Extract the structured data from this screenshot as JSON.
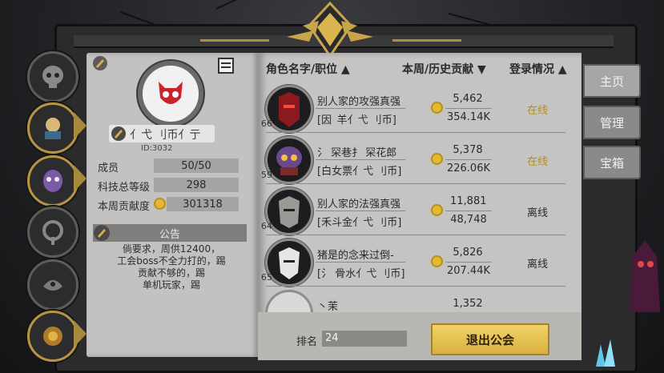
{
  "colors": {
    "gold": "#d9b13f",
    "online": "#b8901c",
    "offline": "#2a2a2a",
    "page": "#c6c4c2"
  },
  "tabs": [
    {
      "label": "主页",
      "active": true
    },
    {
      "label": "管理",
      "active": false
    },
    {
      "label": "宝箱",
      "active": false
    }
  ],
  "side_icons": [
    "skull-icon",
    "knight-icon",
    "purple-mask-icon",
    "orb-icon",
    "crow-icon",
    "golden-emblem-icon"
  ],
  "guild": {
    "name": "亻弋 刂币亻亍",
    "id": "ID:3032",
    "stats": [
      {
        "label": "成员",
        "value": "50/50"
      },
      {
        "label": "科技总等级",
        "value": "298"
      },
      {
        "label": "本周贡献度",
        "value": "301318"
      }
    ],
    "notice_title": "公告",
    "notice_lines": [
      "倘要求，周供12400，",
      "工会boss不全力打的，踢",
      "贡献不够的，踢",
      "单机玩家，踢"
    ]
  },
  "table": {
    "headers": {
      "name": "角色名字/职位 ▲",
      "contrib": "本周/历史贡献 ▼",
      "login": "登录情况 ▲"
    },
    "rows": [
      {
        "level": "66",
        "name": "别人家的攻强真强",
        "title": "[因 羊亻弋 刂币]",
        "week": "5,462",
        "history": "354.14K",
        "status": "在线",
        "online": true
      },
      {
        "level": "59",
        "name": "氵 罙巷扌 罙花郎",
        "title": "[白女票亻弋 刂币]",
        "week": "5,378",
        "history": "226.06K",
        "status": "在线",
        "online": true
      },
      {
        "level": "64",
        "name": "别人家的法强真强",
        "title": "[禾斗金亻弋 刂币]",
        "week": "11,881",
        "history": "48,748",
        "status": "离线",
        "online": false
      },
      {
        "level": "65",
        "name": "猪是的念来过倒-",
        "title": "[氵 骨水亻弋 刂币]",
        "week": "5,826",
        "history": "207.44K",
        "status": "离线",
        "online": false
      },
      {
        "level": "",
        "name": "丶茉",
        "title": "",
        "week": "1,352",
        "history": "",
        "status": "",
        "online": false
      }
    ]
  },
  "rank": {
    "label": "排名",
    "value": "24"
  },
  "exit_button": "退出公会"
}
